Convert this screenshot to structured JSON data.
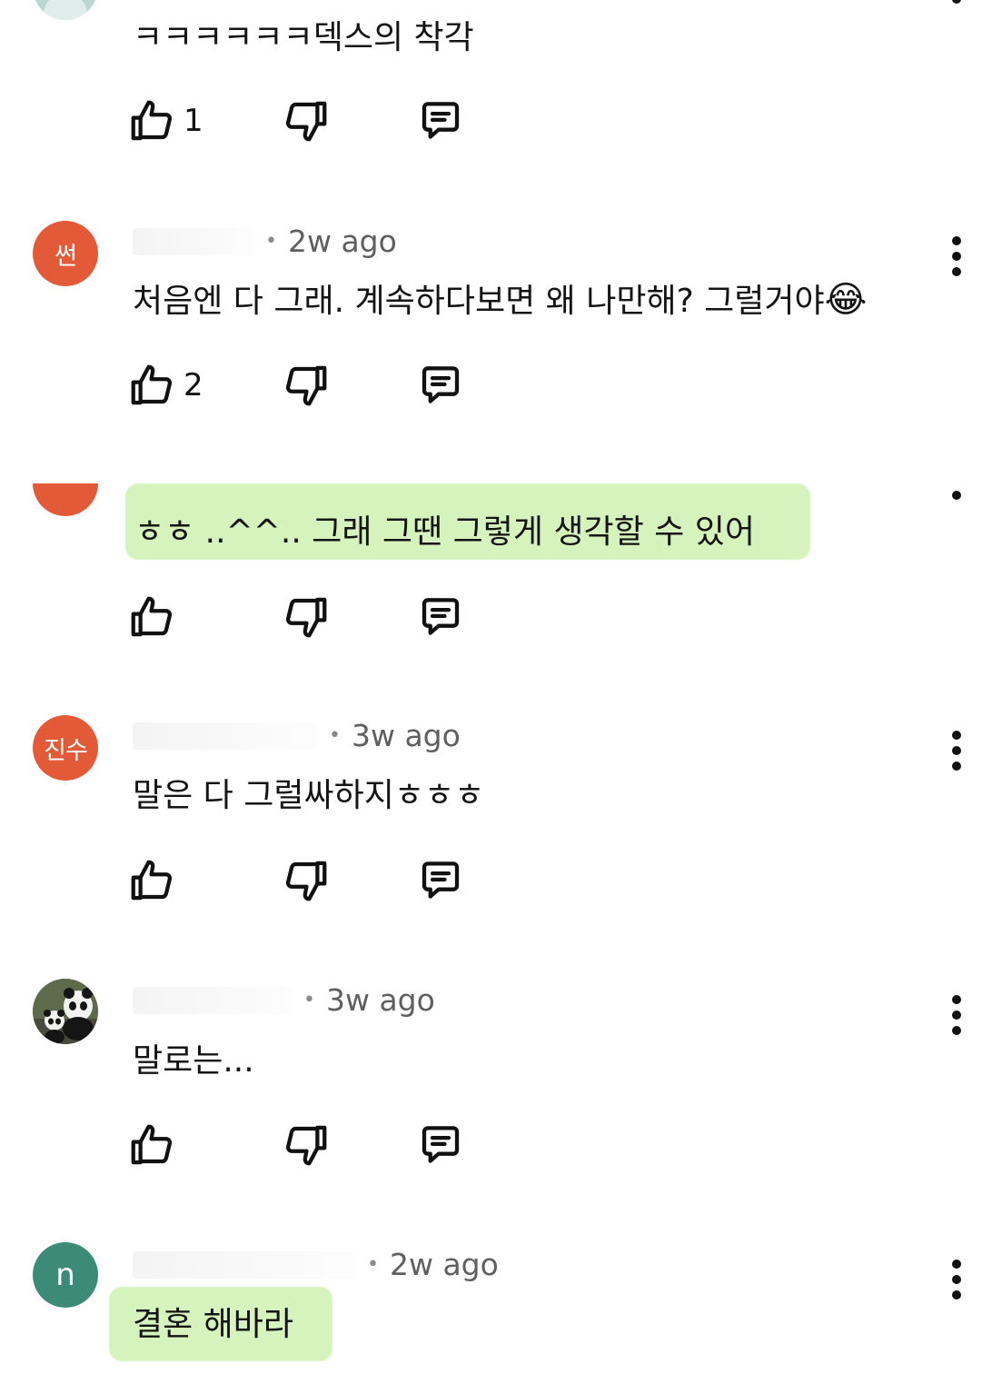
{
  "comments": [
    {
      "avatar": {
        "type": "teal-partial",
        "color": "#b9d8d0"
      },
      "text": "ㅋㅋㅋㅋㅋㅋ덱스의 착각",
      "likes": "1"
    },
    {
      "avatar": {
        "type": "text",
        "label": "썬",
        "color": "#e25a37"
      },
      "time": "2w ago",
      "text": "처음엔 다 그래. 계속하다보면 왜 나만해? 그럴거야",
      "emoji": "😂",
      "likes": "2"
    },
    {
      "avatar": {
        "type": "partial",
        "color": "#e25a37"
      },
      "text": "ㅎㅎ ..^^.. 그래 그땐 그렇게 생각할 수 있어",
      "highlighted": true,
      "likes": ""
    },
    {
      "avatar": {
        "type": "text",
        "label": "진수",
        "color": "#e25a37"
      },
      "time": "3w ago",
      "text": "말은 다 그럴싸하지ㅎㅎㅎ",
      "likes": ""
    },
    {
      "avatar": {
        "type": "image",
        "icon": "panda-photo-icon"
      },
      "time": "3w ago",
      "text": "말로는...",
      "likes": ""
    },
    {
      "avatar": {
        "type": "text",
        "label": "n",
        "color": "#3c8b78"
      },
      "time": "2w ago",
      "text": "결혼 해바라",
      "highlighted": true
    }
  ],
  "icons": {
    "like": "thumbs-up-icon",
    "dislike": "thumbs-down-icon",
    "reply": "reply-icon",
    "more": "more-vertical-icon"
  }
}
